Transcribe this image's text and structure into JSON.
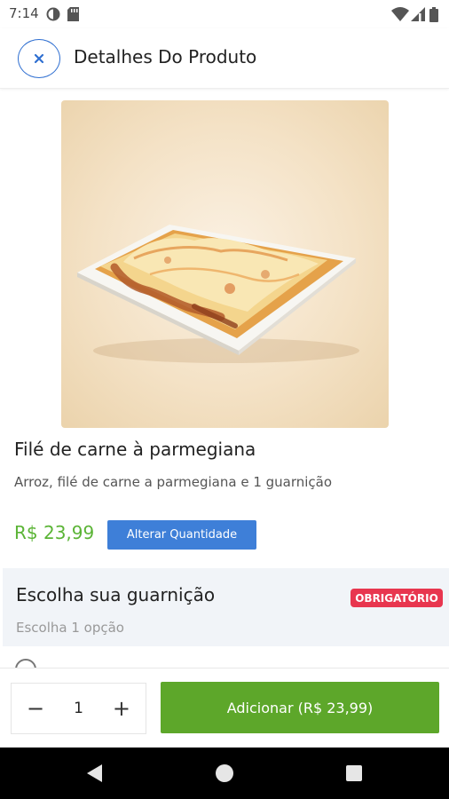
{
  "status_bar": {
    "time": "7:14",
    "icons": [
      "data-saver-icon",
      "sd-card-icon",
      "wifi-icon",
      "signal-icon",
      "battery-icon"
    ]
  },
  "header": {
    "close_icon": "close-icon",
    "title": "Detalhes Do Produto"
  },
  "product": {
    "image": "product-photo-parmegiana",
    "name": "Filé de carne à parmegiana",
    "description": "Arroz, filé de carne a parmegiana e 1 guarnição",
    "price": "R$ 23,99",
    "change_quantity_label": "Alterar Quantidade"
  },
  "options_section": {
    "title": "Escolha sua guarnição",
    "badge": "OBRIGATÓRIO",
    "subtitle": "Escolha 1 opção"
  },
  "cart_bar": {
    "minus_label": "−",
    "quantity": "1",
    "plus_label": "+",
    "add_button_label": "Adicionar (R$ 23,99)"
  },
  "colors": {
    "accent_blue": "#2f6fd1",
    "price_green": "#5bb436",
    "add_button_green": "#5da72a",
    "badge_red": "#e8364f"
  },
  "nav_bar": {
    "icons": [
      "back-icon",
      "home-icon",
      "recents-icon"
    ]
  }
}
